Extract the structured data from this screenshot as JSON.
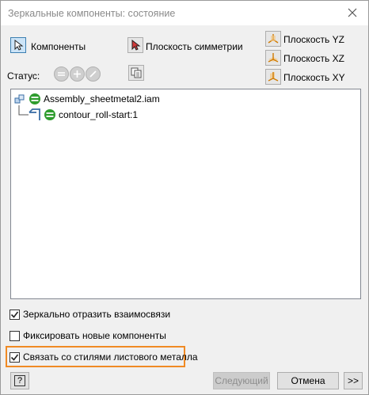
{
  "window": {
    "title": "Зеркальные компоненты: состояние"
  },
  "toolbar": {
    "components_label": "Компоненты",
    "symmetry_plane_label": "Плоскость симметрии",
    "plane_yz_label": "Плоскость YZ",
    "plane_xz_label": "Плоскость XZ",
    "plane_xy_label": "Плоскость XY",
    "status_label": "Статус:"
  },
  "tree": {
    "root_label": "Assembly_sheetmetal2.iam",
    "child_label": "contour_roll-start:1"
  },
  "options": {
    "mirror_relations": {
      "label": "Зеркально отразить взаимосвязи",
      "checked": true
    },
    "fix_new_components": {
      "label": "Фиксировать новые компоненты",
      "checked": false
    },
    "link_sheet_metal_styles": {
      "label": "Связать со стилями листового металла",
      "checked": true
    }
  },
  "footer": {
    "help_label": "?",
    "next_label": "Следующий",
    "cancel_label": "Отмена",
    "more_label": ">>"
  },
  "colors": {
    "highlight": "#f08a24",
    "status_green": "#2e9c2e",
    "accent_blue": "#3c7fb1"
  }
}
